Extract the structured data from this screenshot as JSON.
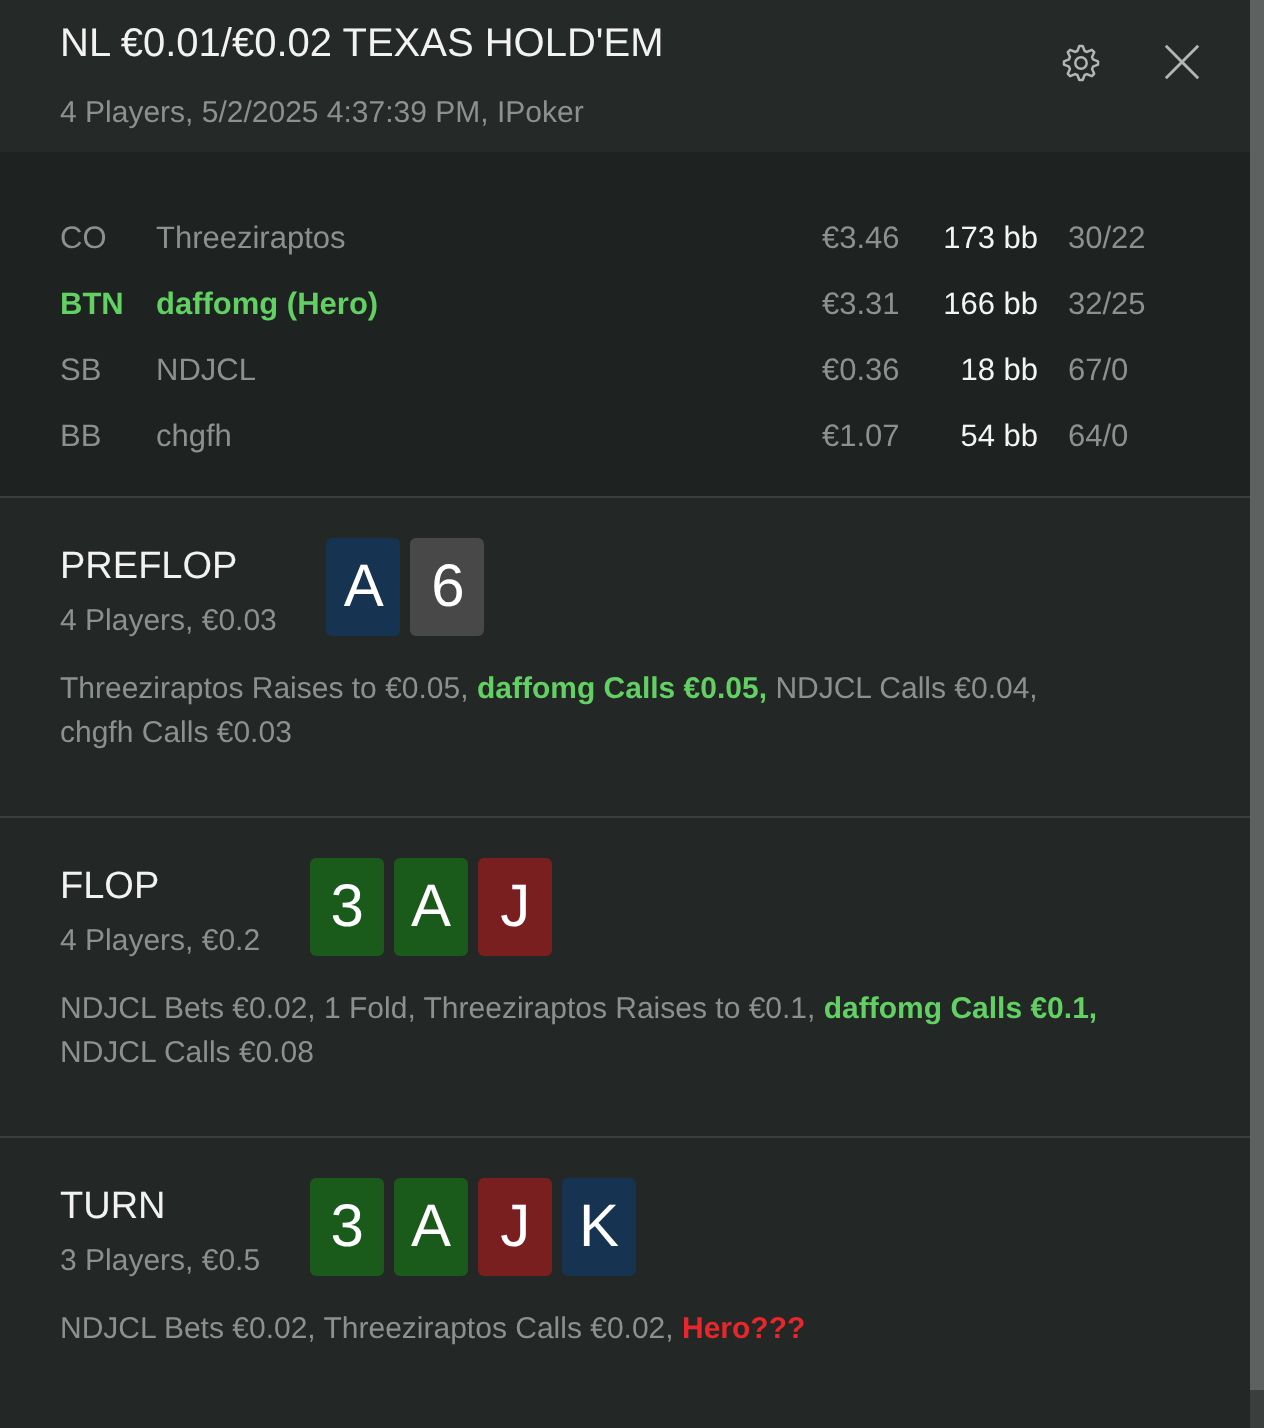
{
  "header": {
    "title": "NL €0.01/€0.02 TEXAS HOLD'EM",
    "subtitle": "4 Players, 5/2/2025 4:37:39 PM, IPoker"
  },
  "players": [
    {
      "position": "CO",
      "name": "Threeziraptos",
      "hero": false,
      "stack": "€3.46",
      "bb": "173 bb",
      "stats": "30/22"
    },
    {
      "position": "BTN",
      "name": "daffomg (Hero)",
      "hero": true,
      "stack": "€3.31",
      "bb": "166 bb",
      "stats": "32/25"
    },
    {
      "position": "SB",
      "name": "NDJCL",
      "hero": false,
      "stack": "€0.36",
      "bb": "18 bb",
      "stats": "67/0"
    },
    {
      "position": "BB",
      "name": "chgfh",
      "hero": false,
      "stack": "€1.07",
      "bb": "54 bb",
      "stats": "64/0"
    }
  ],
  "streets": [
    {
      "name": "PREFLOP",
      "summary": "4 Players, €0.03",
      "cards": [
        {
          "rank": "A",
          "color": "#163352"
        },
        {
          "rank": "6",
          "color": "#484848"
        }
      ],
      "actions": [
        {
          "text": "Threeziraptos Raises to €0.05,",
          "kind": "normal"
        },
        {
          "text": "daffomg Calls €0.05,",
          "kind": "hero"
        },
        {
          "text": "NDJCL Calls €0.04,",
          "kind": "normal"
        },
        {
          "text": "chgfh Calls €0.03",
          "kind": "normal"
        }
      ]
    },
    {
      "name": "FLOP",
      "summary": "4 Players, €0.2",
      "cards": [
        {
          "rank": "3",
          "color": "#1a5a1a"
        },
        {
          "rank": "A",
          "color": "#1a5a1a"
        },
        {
          "rank": "J",
          "color": "#7a1f1f"
        }
      ],
      "actions": [
        {
          "text": "NDJCL Bets €0.02, 1 Fold, Threeziraptos Raises to €0.1,",
          "kind": "normal"
        },
        {
          "text": "daffomg Calls €0.1,",
          "kind": "hero"
        },
        {
          "text": "NDJCL Calls €0.08",
          "kind": "normal"
        }
      ]
    },
    {
      "name": "TURN",
      "summary": "3 Players, €0.5",
      "cards": [
        {
          "rank": "3",
          "color": "#1a5a1a"
        },
        {
          "rank": "A",
          "color": "#1a5a1a"
        },
        {
          "rank": "J",
          "color": "#7a1f1f"
        },
        {
          "rank": "K",
          "color": "#163352"
        }
      ],
      "actions": [
        {
          "text": "NDJCL Bets €0.02, Threeziraptos Calls €0.02,",
          "kind": "normal"
        },
        {
          "text": "Hero???",
          "kind": "pending"
        }
      ]
    }
  ]
}
